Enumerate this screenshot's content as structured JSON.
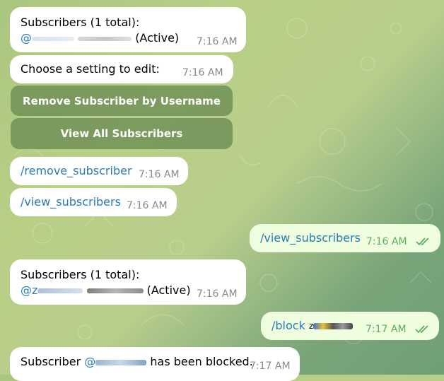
{
  "colors": {
    "link": "#2a7ab6",
    "out_bubble": "#eefedf",
    "keyboard_button": "#577a46",
    "check": "#5fae5e"
  },
  "messages": {
    "m1": {
      "title": "Subscribers (1 total):",
      "handle_prefix": "@",
      "status": "(Active)",
      "time": "7:16 AM"
    },
    "m2": {
      "text": "Choose a setting to edit:",
      "time": "7:16 AM"
    },
    "keyboard": {
      "remove_label": "Remove Subscriber by Username",
      "view_label": "View All Subscribers"
    },
    "m3": {
      "text": "/remove_subscriber",
      "time": "7:16 AM"
    },
    "m4": {
      "text": "/view_subscribers",
      "time": "7:16 AM"
    },
    "m5": {
      "text": "/view_subscribers",
      "time": "7:16 AM"
    },
    "m6": {
      "title": "Subscribers (1 total):",
      "handle_prefix": "@z",
      "status": "(Active)",
      "time": "7:16 AM"
    },
    "m7": {
      "text": "/block",
      "user_prefix": "z",
      "time": "7:17 AM"
    },
    "m8": {
      "prefix": "Subscriber",
      "handle_prefix": "@",
      "suffix": "has been blocked.",
      "time": "7:17 AM"
    }
  }
}
